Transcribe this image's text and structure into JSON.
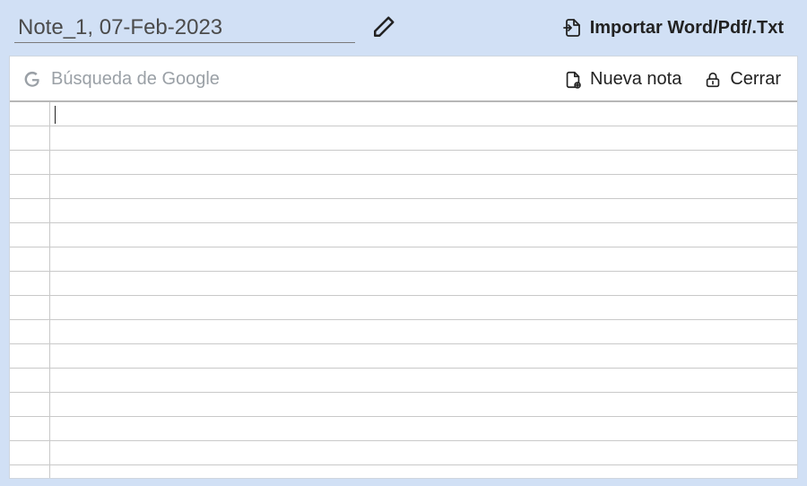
{
  "header": {
    "title": "Note_1, 07-Feb-2023",
    "import_label": "Importar Word/Pdf/.Txt"
  },
  "toolbar": {
    "search_placeholder": "Búsqueda de Google",
    "new_note_label": "Nueva nota",
    "close_label": "Cerrar"
  },
  "colors": {
    "bg": "#d1e0f5"
  }
}
